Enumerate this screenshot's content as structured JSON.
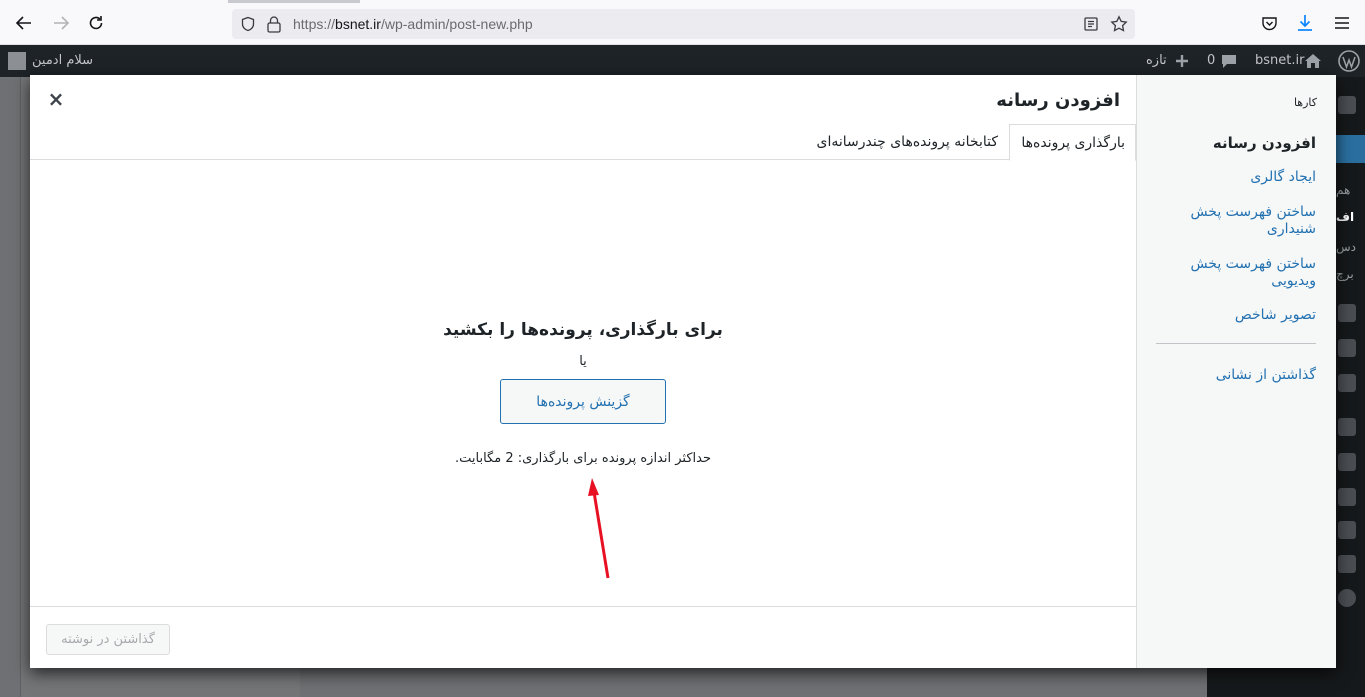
{
  "browser": {
    "url_prefix": "https://",
    "url_host": "bsnet.ir",
    "url_path": "/wp-admin/post-new.php"
  },
  "adminbar": {
    "greeting": "سلام ادمین",
    "new_label": "تازه",
    "comments_count": "0",
    "site_name": "bsnet.ir"
  },
  "sidebar_peek": [
    "هم",
    "اف",
    "دس",
    "برچ"
  ],
  "modal": {
    "title": "افزودن رسانه",
    "close_symbol": "×",
    "menu": {
      "heading": "کارها",
      "items": [
        {
          "label": "افزودن رسانه",
          "active": true
        },
        {
          "label": "ایجاد گالری",
          "active": false
        },
        {
          "label": "ساختن فهرست پخش شنیداری",
          "active": false
        },
        {
          "label": "ساختن فهرست پخش ویدیویی",
          "active": false
        },
        {
          "label": "تصویر شاخص",
          "active": false
        },
        {
          "label": "گذاشتن از نشانی",
          "active": false
        }
      ]
    },
    "tabs": [
      {
        "label": "بارگذاری پرونده‌ها",
        "active": true
      },
      {
        "label": "کتابخانه پرونده‌های چندرسانه‌ای",
        "active": false
      }
    ],
    "uploader": {
      "drop_title": "برای بارگذاری، پرونده‌ها را بکشید",
      "or_text": "یا",
      "select_button": "گزینش پرونده‌ها",
      "max_size": "حداکثر اندازه پرونده برای بارگذاری: 2 مگابایت."
    },
    "insert_button": "گذاشتن در نوشته"
  },
  "colors": {
    "accent": "#2271b1",
    "annotation_arrow": "#e81123"
  }
}
